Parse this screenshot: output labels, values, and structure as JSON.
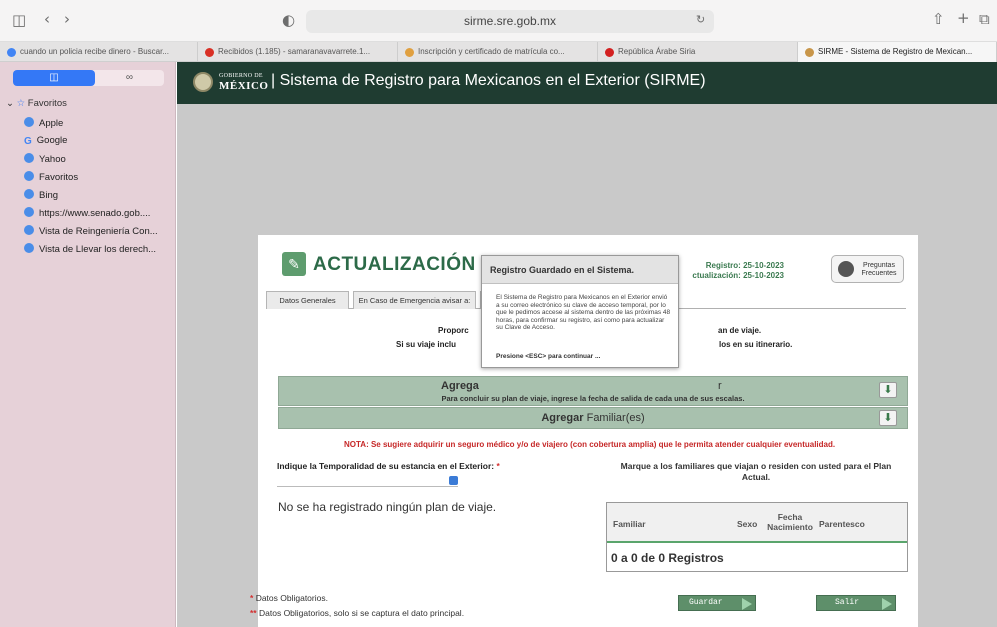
{
  "browser": {
    "url": "sirme.sre.gob.mx",
    "tabs": [
      {
        "label": "cuando un policia recibe dinero - Buscar...",
        "color": "#4285f4",
        "active": false
      },
      {
        "label": "Recibidos (1.185) - samaranavavarrete.1...",
        "color": "#d93025",
        "active": false
      },
      {
        "label": "Inscripción y certificado de matrícula co...",
        "color": "#e0a040",
        "active": false
      },
      {
        "label": "República Árabe Siria",
        "color": "#d32020",
        "active": false
      },
      {
        "label": "SIRME - Sistema de Registro de Mexican...",
        "color": "#c8964a",
        "active": true
      }
    ]
  },
  "sidebar": {
    "segment_a": "◫",
    "segment_b": "∞",
    "favorites_title": "Favoritos",
    "items": [
      {
        "label": "Apple",
        "icon": "globe-icon"
      },
      {
        "label": "Google",
        "icon": "google-icon"
      },
      {
        "label": "Yahoo",
        "icon": "globe-icon"
      },
      {
        "label": "Favoritos",
        "icon": "globe-icon"
      },
      {
        "label": "Bing",
        "icon": "globe-icon"
      },
      {
        "label": "https://www.senado.gob....",
        "icon": "globe-icon"
      },
      {
        "label": "Vista de Reingeniería Con...",
        "icon": "globe-icon"
      },
      {
        "label": "Vista de Llevar los derech...",
        "icon": "globe-icon"
      }
    ]
  },
  "header": {
    "logo_line1": "GOBIERNO DE",
    "logo_line2": "MÉXICO",
    "title": "| Sistema de Registro para Mexicanos en el Exterior (SIRME)"
  },
  "page": {
    "title": "ACTUALIZACIÓN",
    "registro": "Registro: 25-10-2023",
    "actualizacion": "ctualización: 25-10-2023",
    "faq_label": "Preguntas Frecuentes",
    "tabs": [
      "Datos Generales",
      "En Caso de Emergencia avisar a:",
      "P"
    ],
    "intro_left_1": "Proporc",
    "intro_left_2": "Si su viaje inclu",
    "intro_right_1": "an de viaje.",
    "intro_right_2": "los en su itinerario.",
    "plan_bar_bold": "Agrega",
    "plan_bar_tail": "r",
    "plan_bar_sub": "Para concluir su plan de viaje, ingrese la fecha de salida de cada una de sus escalas.",
    "familiar_bar_bold": "Agregar",
    "familiar_bar_rest": "Familiar(es)",
    "note": "NOTA: Se sugiere adquirir un seguro médico y/o de viajero (con cobertura amplia) que le permita atender cualquier eventualidad.",
    "temporalidad_label": "Indique la Temporalidad de su estancia en el Exterior:",
    "required_mark": "*",
    "no_plan": "No se ha registrado ningún plan de viaje.",
    "familiares_label": "Marque a los familiares que viajan o residen con usted para el Plan Actual.",
    "table_headers": [
      "Familiar",
      "Sexo",
      "Fecha Nacimiento",
      "Parentesco"
    ],
    "records": "0 a 0 de 0 Registros",
    "legend_1": "Datos Obligatorios.",
    "legend_2": "Datos Obligatorios, solo si se captura el dato principal.",
    "legend_star_1": "*",
    "legend_star_2": "**",
    "btn_guardar": "Guardar",
    "btn_salir": "Salir"
  },
  "modal": {
    "title": "Registro Guardado en el Sistema.",
    "body": "El Sistema de Registro para Mexicanos en el Exterior envió a su correo electrónico su clave de acceso temporal, por lo que le pedimos accese al sistema dentro de las próximas 48 horas, para confirmar su registro, así como para actualizar su Clave de Acceso.",
    "esc": "Presione <ESC> para continuar ..."
  }
}
